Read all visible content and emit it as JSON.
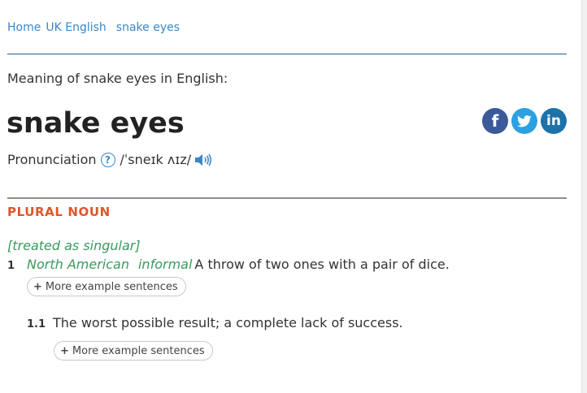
{
  "breadcrumb": {
    "items": [
      "Home",
      "UK English",
      "snake eyes"
    ]
  },
  "entry": {
    "meaning_text": "Meaning of snake eyes in English:",
    "headword": "snake eyes",
    "pronunciation_label": "Pronunciation",
    "help_glyph": "?",
    "phonetic": "/ˈsneɪk ʌɪz/",
    "part_of_speech": "PLURAL NOUN",
    "grammar_note": "[treated as singular]",
    "senses": [
      {
        "number": "1",
        "labels": [
          "North American",
          "informal"
        ],
        "definition": "A throw of two ones with a pair of dice.",
        "more_button": {
          "plus": "+",
          "label": "More example sentences"
        }
      },
      {
        "number": "1.1",
        "definition": "The worst possible result; a complete lack of success.",
        "more_button": {
          "plus": "+",
          "label": "More example sentences"
        }
      }
    ]
  },
  "social": {
    "facebook_glyph": "f",
    "linkedin_glyph": "in",
    "icons": [
      "facebook-icon",
      "twitter-icon",
      "linkedin-icon"
    ]
  },
  "colors": {
    "link": "#3a87c8",
    "part_of_speech": "#e0552b",
    "label_green": "#3a9a5e",
    "facebook": "#3c5a99",
    "twitter": "#2ba1e2",
    "linkedin": "#1d72a8"
  }
}
